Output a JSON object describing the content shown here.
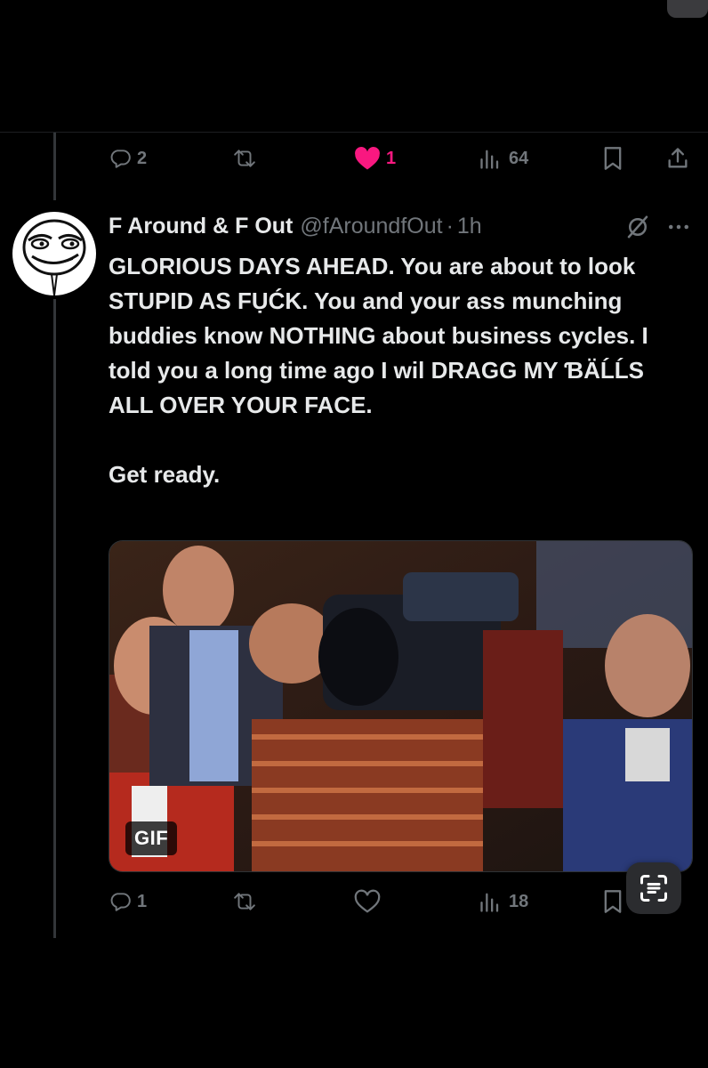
{
  "top_actions": {
    "reply_count": "2",
    "like_count": "1",
    "views_count": "64"
  },
  "tweet": {
    "display_name": "F Around & F Out",
    "handle": "@fAroundfOut",
    "separator": "·",
    "time": "1h",
    "text": "GLORIOUS DAYS AHEAD. You are about to look STUPID AS FỤĆK. You and your ass munching buddies know NOTHING about business cycles. I told you a long time ago I wil DRAGG MY ƁÄĹĹS ALL OVER YOUR FACE.\n\nGet ready.",
    "media_badge": "GIF"
  },
  "bottom_actions": {
    "reply_count": "1",
    "views_count": "18"
  },
  "colors": {
    "background": "#000000",
    "text": "#e7e9ea",
    "muted": "#71767b",
    "like": "#f91880",
    "thread_line": "#333639"
  },
  "icons": [
    "reply-icon",
    "retweet-icon",
    "heart-icon",
    "views-icon",
    "bookmark-icon",
    "share-icon",
    "grok-icon",
    "more-icon",
    "live-text-scan-icon"
  ]
}
